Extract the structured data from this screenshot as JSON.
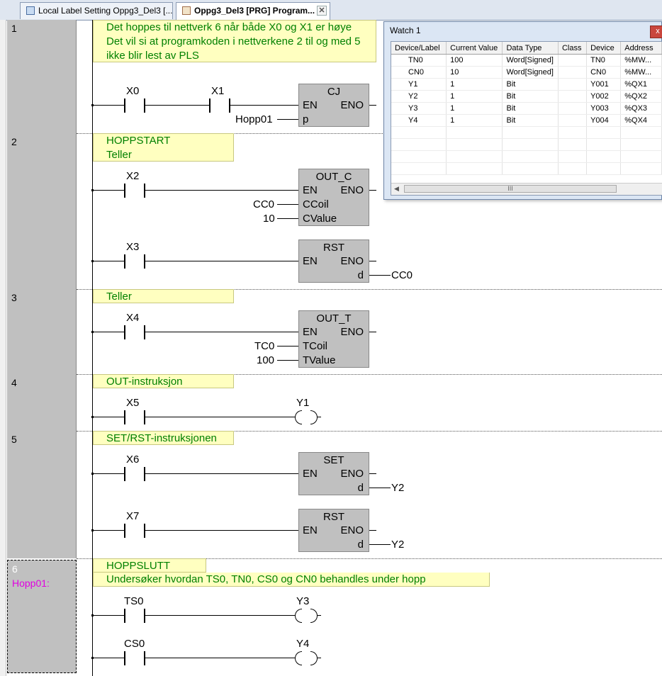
{
  "tabs": [
    {
      "label": "Local Label Setting Oppg3_Del3 [..."
    },
    {
      "label": "Oppg3_Del3 [PRG] Program...",
      "close": "✕"
    }
  ],
  "networks": [
    {
      "num": "1",
      "comments": [
        "Det hoppes til nettverk 6 når både X0 og X1 er høye",
        "Det vil si at programkoden i nettverkene 2 til og med 5",
        "ikke blir lest av PLS"
      ],
      "contacts": [
        "X0",
        "X1"
      ],
      "block": {
        "title": "CJ",
        "en": "EN",
        "eno": "ENO",
        "pin": "p",
        "pin_label": "Hopp01"
      }
    },
    {
      "num": "2",
      "comments": [
        "HOPPSTART",
        "Teller"
      ],
      "rung1": {
        "contact": "X2",
        "block": {
          "title": "OUT_C",
          "en": "EN",
          "eno": "ENO",
          "pin1": "CCoil",
          "pin1_label": "CC0",
          "pin2": "CValue",
          "pin2_label": "10"
        }
      },
      "rung2": {
        "contact": "X3",
        "block": {
          "title": "RST",
          "en": "EN",
          "eno": "ENO",
          "pin": "d",
          "pin_label": "CC0"
        }
      }
    },
    {
      "num": "3",
      "comments": [
        "Teller"
      ],
      "contact": "X4",
      "block": {
        "title": "OUT_T",
        "en": "EN",
        "eno": "ENO",
        "pin1": "TCoil",
        "pin1_label": "TC0",
        "pin2": "TValue",
        "pin2_label": "100"
      }
    },
    {
      "num": "4",
      "comments": [
        "OUT-instruksjon"
      ],
      "contact": "X5",
      "coil": "Y1"
    },
    {
      "num": "5",
      "comments": [
        "SET/RST-instruksjonen"
      ],
      "rung1": {
        "contact": "X6",
        "block": {
          "title": "SET",
          "en": "EN",
          "eno": "ENO",
          "pin": "d",
          "pin_label": "Y2"
        }
      },
      "rung2": {
        "contact": "X7",
        "block": {
          "title": "RST",
          "en": "EN",
          "eno": "ENO",
          "pin": "d",
          "pin_label": "Y2"
        }
      }
    },
    {
      "num": "6",
      "label": "Hopp01:",
      "comments": [
        "HOPPSLUTT",
        "Undersøker hvordan TS0, TN0, CS0 og CN0 behandles under hopp"
      ],
      "rung1": {
        "contact": "TS0",
        "coil": "Y3"
      },
      "rung2": {
        "contact": "CS0",
        "coil": "Y4"
      }
    }
  ],
  "watch": {
    "title": "Watch 1",
    "close": "x",
    "columns": [
      "Device/Label",
      "Current Value",
      "Data Type",
      "Class",
      "Device",
      "Address"
    ],
    "rows": [
      [
        "TN0",
        "100",
        "Word[Signed]",
        "",
        "TN0",
        "%MW..."
      ],
      [
        "CN0",
        "10",
        "Word[Signed]",
        "",
        "CN0",
        "%MW..."
      ],
      [
        "Y1",
        "1",
        "Bit",
        "",
        "Y001",
        "%QX1"
      ],
      [
        "Y2",
        "1",
        "Bit",
        "",
        "Y002",
        "%QX2"
      ],
      [
        "Y3",
        "1",
        "Bit",
        "",
        "Y003",
        "%QX3"
      ],
      [
        "Y4",
        "1",
        "Bit",
        "",
        "Y004",
        "%QX4"
      ]
    ],
    "scroll_thumb": "III"
  }
}
